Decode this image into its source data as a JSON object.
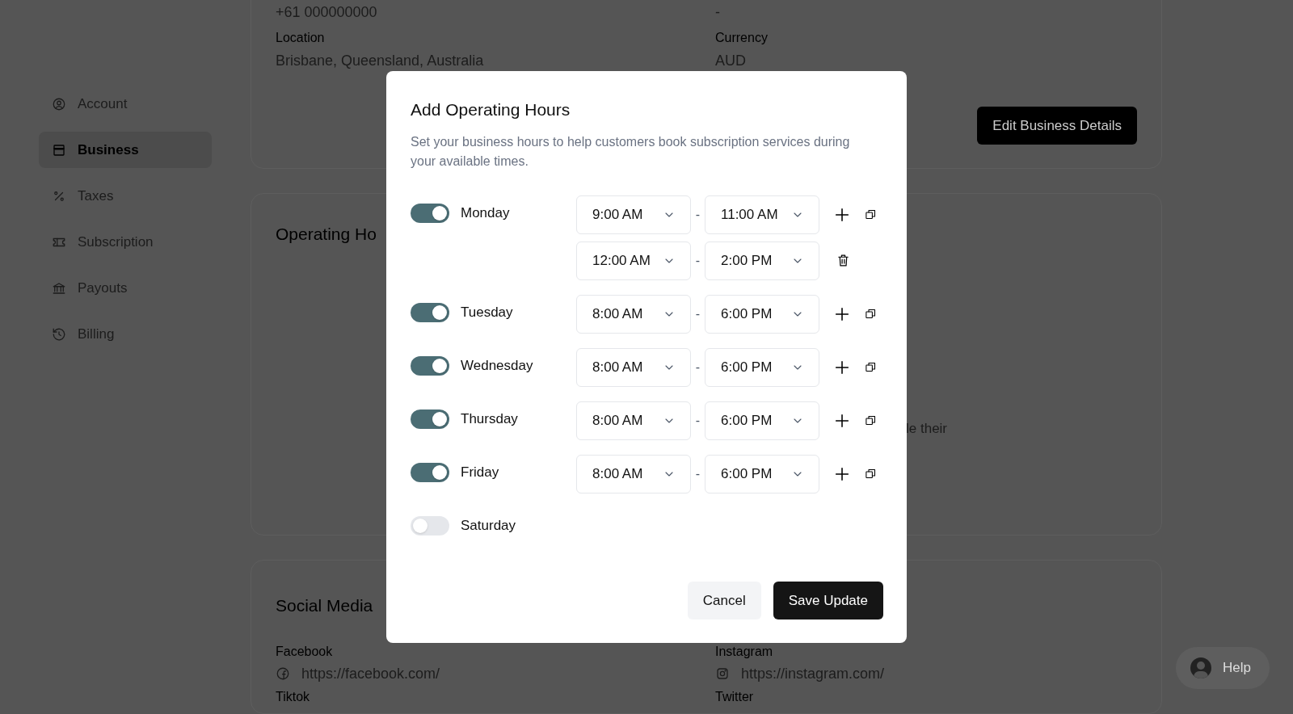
{
  "sidebar": {
    "items": [
      {
        "label": "Account",
        "selected": false
      },
      {
        "label": "Business",
        "selected": true
      },
      {
        "label": "Taxes",
        "selected": false
      },
      {
        "label": "Subscription",
        "selected": false
      },
      {
        "label": "Payouts",
        "selected": false
      },
      {
        "label": "Billing",
        "selected": false
      }
    ]
  },
  "business_card": {
    "fields": [
      {
        "value": "+61 000000000"
      },
      {
        "value": "-"
      },
      {
        "label": "Location",
        "value": "Brisbane, Queensland, Australia"
      },
      {
        "label": "Currency",
        "value": "AUD"
      }
    ],
    "button": "Edit Business Details"
  },
  "operating_card": {
    "title": "Operating Ho",
    "text_fragment": "le their"
  },
  "social_card": {
    "title": "Social Media",
    "fields": [
      {
        "label": "Facebook",
        "value": "https://facebook.com/",
        "kind": "facebook"
      },
      {
        "label": "Instagram",
        "value": "https://instagram.com/",
        "kind": "instagram"
      },
      {
        "label": "Tiktok"
      },
      {
        "label": "Twitter"
      }
    ]
  },
  "help_button": "Help",
  "modal": {
    "title": "Add Operating Hours",
    "description": "Set your business hours to help customers book subscription services during your available times.",
    "days": [
      {
        "name": "Monday",
        "on": true,
        "slots": [
          {
            "start": "9:00 AM",
            "end": "11:00 AM"
          },
          {
            "start": "12:00 AM",
            "end": "2:00 PM"
          }
        ]
      },
      {
        "name": "Tuesday",
        "on": true,
        "slots": [
          {
            "start": "8:00 AM",
            "end": "6:00 PM"
          }
        ]
      },
      {
        "name": "Wednesday",
        "on": true,
        "slots": [
          {
            "start": "8:00 AM",
            "end": "6:00 PM"
          }
        ]
      },
      {
        "name": "Thursday",
        "on": true,
        "slots": [
          {
            "start": "8:00 AM",
            "end": "6:00 PM"
          }
        ]
      },
      {
        "name": "Friday",
        "on": true,
        "slots": [
          {
            "start": "8:00 AM",
            "end": "6:00 PM"
          }
        ]
      },
      {
        "name": "Saturday",
        "on": false
      }
    ],
    "separator": "-",
    "buttons": {
      "cancel": "Cancel",
      "save": "Save Update"
    }
  }
}
